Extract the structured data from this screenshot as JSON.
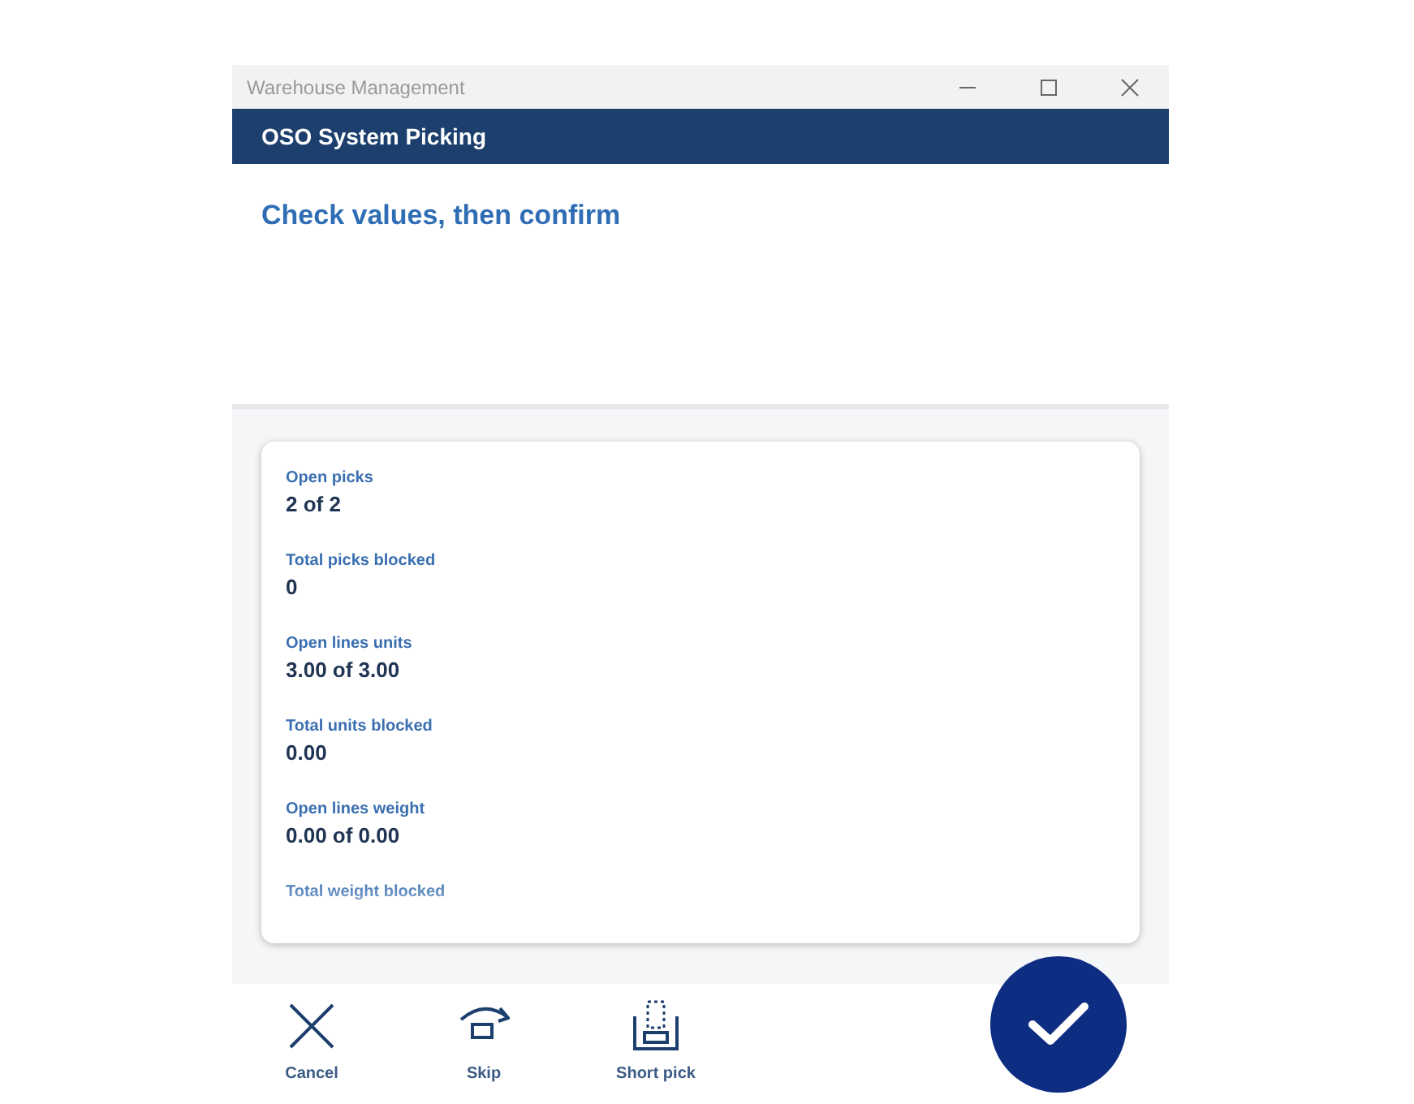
{
  "window": {
    "title": "Warehouse Management"
  },
  "header": {
    "title": "OSO System Picking"
  },
  "instruction": "Check values, then confirm",
  "fields": [
    {
      "label": "Open picks",
      "value": "2 of 2"
    },
    {
      "label": "Total picks blocked",
      "value": "0"
    },
    {
      "label": "Open lines units",
      "value": "3.00 of 3.00"
    },
    {
      "label": "Total units blocked",
      "value": "0.00"
    },
    {
      "label": "Open lines weight",
      "value": "0.00 of 0.00"
    },
    {
      "label": "Total weight blocked"
    }
  ],
  "actions": [
    {
      "kind": "cancel",
      "label": "Cancel"
    },
    {
      "kind": "skip",
      "label": "Skip"
    },
    {
      "kind": "short",
      "label": "Short pick"
    }
  ]
}
